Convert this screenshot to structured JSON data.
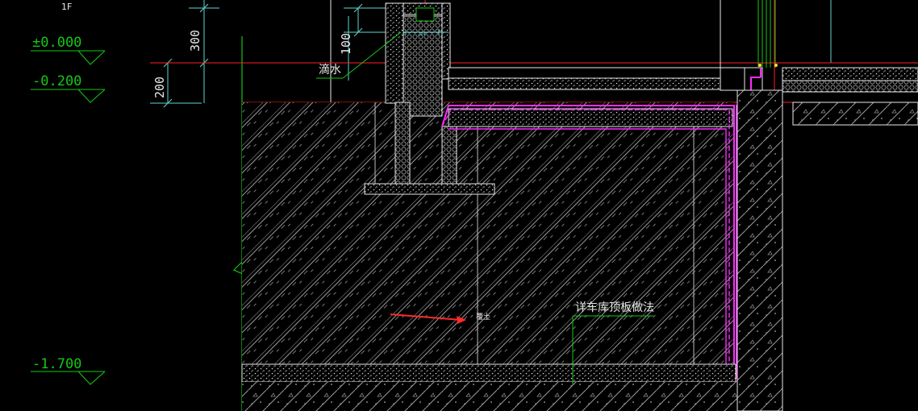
{
  "colors": {
    "background": "#000000",
    "red": "#ff2020",
    "green": "#14c814",
    "cyan": "#5fd6cf",
    "magenta": "#ff2bff",
    "white": "#e8e8e8",
    "gray": "#8a8a8a",
    "arrow": "#ff2a2a"
  },
  "drawing": {
    "floor_label": "1F",
    "levels": [
      "±0.000",
      "-0.200",
      "-1.700"
    ],
    "dimensions": [
      "300",
      "200",
      "100"
    ],
    "annotations": {
      "drip": "滴水",
      "fill": "覆土",
      "garage_roof_note": "详车库顶板做法",
      "small_dim": "224"
    }
  }
}
